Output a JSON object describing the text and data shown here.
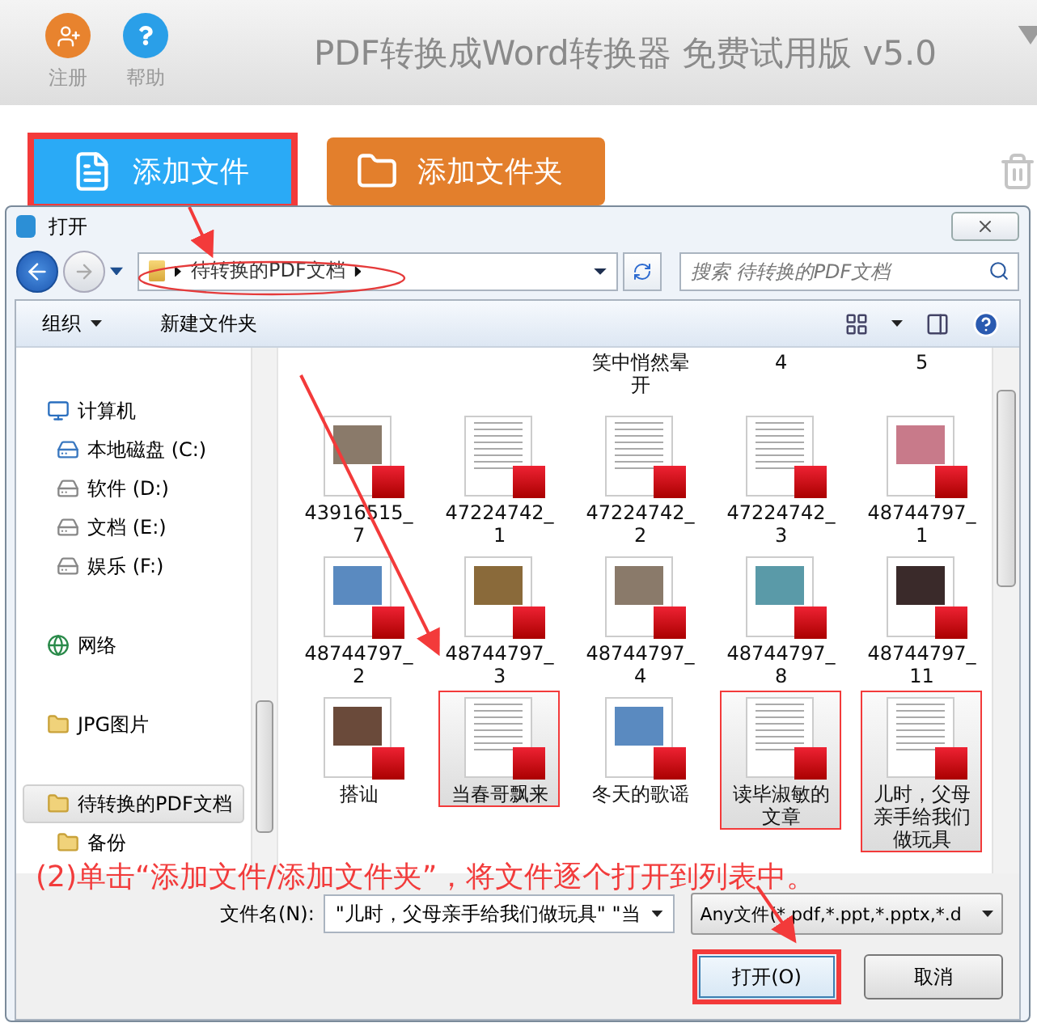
{
  "app": {
    "title": "PDF转换成Word转换器 免费试用版 v5.0",
    "header_buttons": [
      {
        "kind": "register",
        "label": "注册"
      },
      {
        "kind": "help",
        "label": "帮助"
      }
    ]
  },
  "toolbar": {
    "buttons": [
      {
        "kind": "file",
        "label": "添加文件",
        "highlighted": true
      },
      {
        "kind": "folder",
        "label": "添加文件夹",
        "highlighted": false
      }
    ]
  },
  "dialog": {
    "title": "打开",
    "path": [
      "待转换的PDF文档"
    ],
    "search": {
      "placeholder": "搜索 待转换的PDF文档"
    },
    "commands": [
      {
        "label": "组织",
        "kind": "menu"
      },
      {
        "label": "新建文件夹",
        "kind": "plain"
      }
    ],
    "nav": [
      {
        "label": "计算机",
        "kind": "computer",
        "selected": false,
        "children": [
          {
            "label": "本地磁盘 (C:)",
            "kind": "system-drive",
            "selected": false
          },
          {
            "label": "软件 (D:)",
            "kind": "drive",
            "selected": false
          },
          {
            "label": "文档 (E:)",
            "kind": "drive",
            "selected": false
          },
          {
            "label": "娱乐 (F:)",
            "kind": "drive",
            "selected": false
          }
        ]
      },
      {
        "label": "网络",
        "kind": "network",
        "selected": false
      },
      {
        "label": "JPG图片",
        "kind": "folder",
        "selected": false
      },
      {
        "label": "待转换的PDF文档",
        "kind": "folder",
        "selected": true,
        "children": [
          {
            "label": "备份",
            "kind": "folder",
            "selected": false
          }
        ]
      }
    ],
    "files_partial": [
      "笑中悄然晕开",
      "4",
      "5"
    ],
    "files": [
      {
        "label": "43916515_7",
        "kind": "photo",
        "selected": false
      },
      {
        "label": "47224742_1",
        "kind": "text",
        "selected": false
      },
      {
        "label": "47224742_2",
        "kind": "text",
        "selected": false
      },
      {
        "label": "47224742_3",
        "kind": "text",
        "selected": false
      },
      {
        "label": "48744797_1",
        "kind": "photo",
        "selected": false
      },
      {
        "label": "48744797_2",
        "kind": "photo",
        "selected": false
      },
      {
        "label": "48744797_3",
        "kind": "photo",
        "selected": false
      },
      {
        "label": "48744797_4",
        "kind": "photo",
        "selected": false
      },
      {
        "label": "48744797_8",
        "kind": "photo",
        "selected": false
      },
      {
        "label": "48744797_11",
        "kind": "photo",
        "selected": false
      },
      {
        "label": "搭讪",
        "kind": "photo",
        "selected": false
      },
      {
        "label": "当春哥飘来",
        "kind": "text",
        "selected": true
      },
      {
        "label": "冬天的歌谣",
        "kind": "photo",
        "selected": false
      },
      {
        "label": "读毕淑敏的文章",
        "kind": "text",
        "selected": true
      },
      {
        "label": "儿时，父母亲手给我们做玩具",
        "kind": "text",
        "selected": true
      }
    ],
    "file_name": {
      "label": "文件名(N):",
      "value": "\"儿时，父母亲手给我们做玩具\" \"当"
    },
    "file_type": "Any文件(*.pdf,*.ppt,*.pptx,*.d",
    "buttons": [
      {
        "label": "打开(O)",
        "kind": "primary",
        "highlighted": true
      },
      {
        "label": "取消",
        "kind": "plain",
        "highlighted": false
      }
    ]
  },
  "annotation": {
    "text": "(2)单击“添加文件/添加文件夹”，将文件逐个打开到列表中。"
  }
}
